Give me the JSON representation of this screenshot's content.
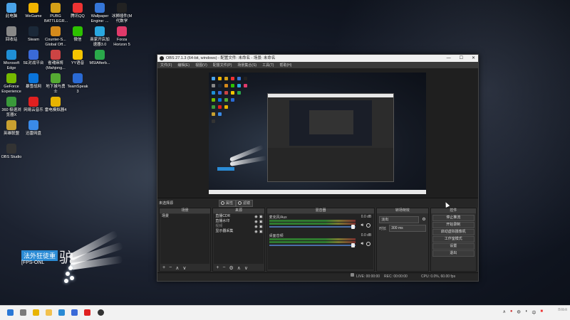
{
  "desktop_icons": [
    {
      "label": "此电脑",
      "color": "#4aa3e8"
    },
    {
      "label": "WeGame",
      "color": "#f0b400"
    },
    {
      "label": "PUBG BATTLEGR...",
      "color": "#d4a017"
    },
    {
      "label": "腾讯QQ",
      "color": "#e33"
    },
    {
      "label": "Wallpaper Engine: ...",
      "color": "#3576d8"
    },
    {
      "label": "冰狮插件(M 代数学",
      "color": "#222"
    },
    {
      "label": "回收站",
      "color": "#888"
    },
    {
      "label": "Steam",
      "color": "#1b2838"
    },
    {
      "label": "Counter-S... Global Off...",
      "color": "#d48a1b"
    },
    {
      "label": "微信",
      "color": "#2dc100"
    },
    {
      "label": "商家开店加速器3.0",
      "color": "#2aa8e0"
    },
    {
      "label": "Forza Horizon 5",
      "color": "#e03a6a"
    },
    {
      "label": "Microsoft Edge",
      "color": "#1f8fd6"
    },
    {
      "label": "5E对战平台",
      "color": "#3a6ad8"
    },
    {
      "label": "雀魂麻将 (Mahjong...",
      "color": "#c44"
    },
    {
      "label": "YY语音",
      "color": "#f4c400"
    },
    {
      "label": "MSIAfterb...",
      "color": "#2aa84a"
    },
    {
      "label": "GeForce Experience",
      "color": "#76b900"
    },
    {
      "label": "暴雪战网",
      "color": "#0a74da"
    },
    {
      "label": "地下城与勇士",
      "color": "#5a3"
    },
    {
      "label": "TeamSpeak 3",
      "color": "#2a6ad4"
    },
    {
      "label": "360 极速浏览器X",
      "color": "#3a9a3a"
    },
    {
      "label": "网易云音乐",
      "color": "#e02020"
    },
    {
      "label": "雷电模拟器4",
      "color": "#e8b400"
    },
    {
      "label": "英雄联盟",
      "color": "#c8a030"
    },
    {
      "label": "迅雷网盘",
      "color": "#3a8ae8"
    },
    {
      "label": "OBS Studio",
      "color": "#333"
    }
  ],
  "overlay": {
    "line1": "法外狂徒重",
    "line2": "[FPS-ONL",
    "big": "驴"
  },
  "obs": {
    "title": "OBS 27.1.3 (64-bit, windows) - 配置文件: 未命名 - 场景: 未命名",
    "menu": [
      "文件(F)",
      "编辑(E)",
      "视图(V)",
      "配置文件(P)",
      "场景集合(S)",
      "工具(T)",
      "帮助(H)"
    ],
    "source_bar": {
      "label": "未选择源",
      "properties": "属性",
      "filters": "滤镜"
    },
    "docks": {
      "scenes": {
        "title": "场景",
        "items": [
          "场景"
        ]
      },
      "sources": {
        "title": "来源",
        "items": [
          "直播CDR",
          "直播水印",
          "视频",
          "显示器采集"
        ]
      },
      "mixer": {
        "title": "混音器",
        "channels": [
          {
            "name": "麦克风/Aux",
            "db": "0.0 dB"
          },
          {
            "name": "桌面音频",
            "db": "0.0 dB"
          }
        ]
      },
      "transitions": {
        "title": "转场特效",
        "type": "淡出",
        "duration_label": "时长",
        "duration_value": "300 ms"
      },
      "controls": {
        "title": "控件",
        "buttons": [
          "停止推流",
          "开始录制",
          "启动虚拟摄像机",
          "工作室模式",
          "设置",
          "退出"
        ]
      }
    },
    "status": {
      "live": "LIVE: 00:00:00",
      "rec": "REC: 00:00:00",
      "cpu": "CPU: 0.0%, 60.00 fps"
    }
  },
  "taskbar": {
    "clock_time": "",
    "clock_date": "",
    "tray_language": "中",
    "watermark": "Bilibili"
  }
}
